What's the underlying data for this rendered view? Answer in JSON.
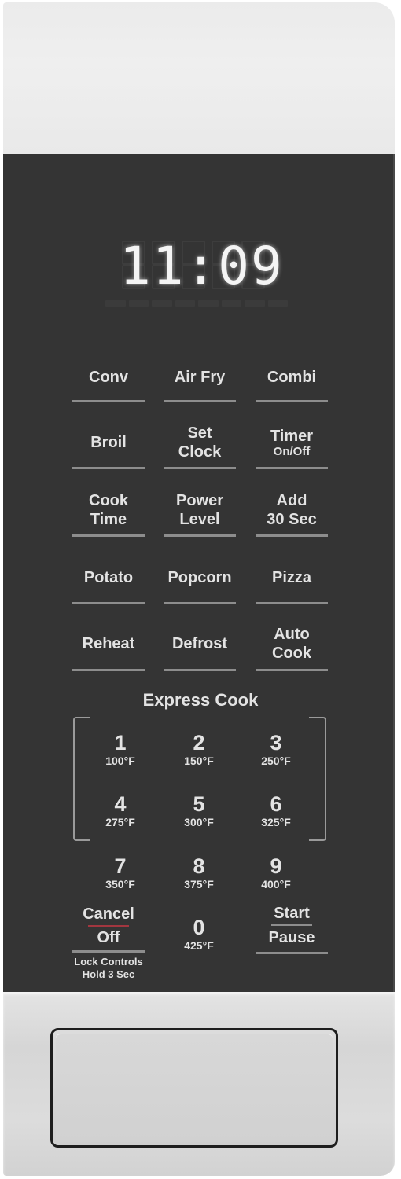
{
  "display": {
    "time": "11:09"
  },
  "colors": {
    "panel": "#343434",
    "text": "#e3e3e3",
    "underline": "#8d8d8d",
    "cancel_accent": "#a2363f",
    "trim": "#e6e6e6"
  },
  "function_buttons": [
    {
      "label": "Conv",
      "sublabel": ""
    },
    {
      "label": "Air Fry",
      "sublabel": ""
    },
    {
      "label": "Combi",
      "sublabel": ""
    },
    {
      "label": "Broil",
      "sublabel": ""
    },
    {
      "label": "Set\nClock",
      "sublabel": ""
    },
    {
      "label": "Timer",
      "sublabel": "On/Off"
    },
    {
      "label": "Cook\nTime",
      "sublabel": ""
    },
    {
      "label": "Power\nLevel",
      "sublabel": ""
    },
    {
      "label": "Add\n30 Sec",
      "sublabel": ""
    },
    {
      "label": "Potato",
      "sublabel": ""
    },
    {
      "label": "Popcorn",
      "sublabel": ""
    },
    {
      "label": "Pizza",
      "sublabel": ""
    },
    {
      "label": "Reheat",
      "sublabel": ""
    },
    {
      "label": "Defrost",
      "sublabel": ""
    },
    {
      "label": "Auto\nCook",
      "sublabel": ""
    }
  ],
  "express_cook": {
    "title": "Express Cook",
    "keys": [
      {
        "number": "1",
        "temp": "100°F"
      },
      {
        "number": "2",
        "temp": "150°F"
      },
      {
        "number": "3",
        "temp": "250°F"
      },
      {
        "number": "4",
        "temp": "275°F"
      },
      {
        "number": "5",
        "temp": "300°F"
      },
      {
        "number": "6",
        "temp": "325°F"
      },
      {
        "number": "7",
        "temp": "350°F"
      },
      {
        "number": "8",
        "temp": "375°F"
      },
      {
        "number": "9",
        "temp": "400°F"
      },
      {
        "number": "0",
        "temp": "425°F"
      }
    ]
  },
  "cancel_button": {
    "top": "Cancel",
    "bottom": "Off",
    "hint_line1": "Lock Controls",
    "hint_line2": "Hold 3 Sec"
  },
  "start_button": {
    "top": "Start",
    "bottom": "Pause"
  }
}
